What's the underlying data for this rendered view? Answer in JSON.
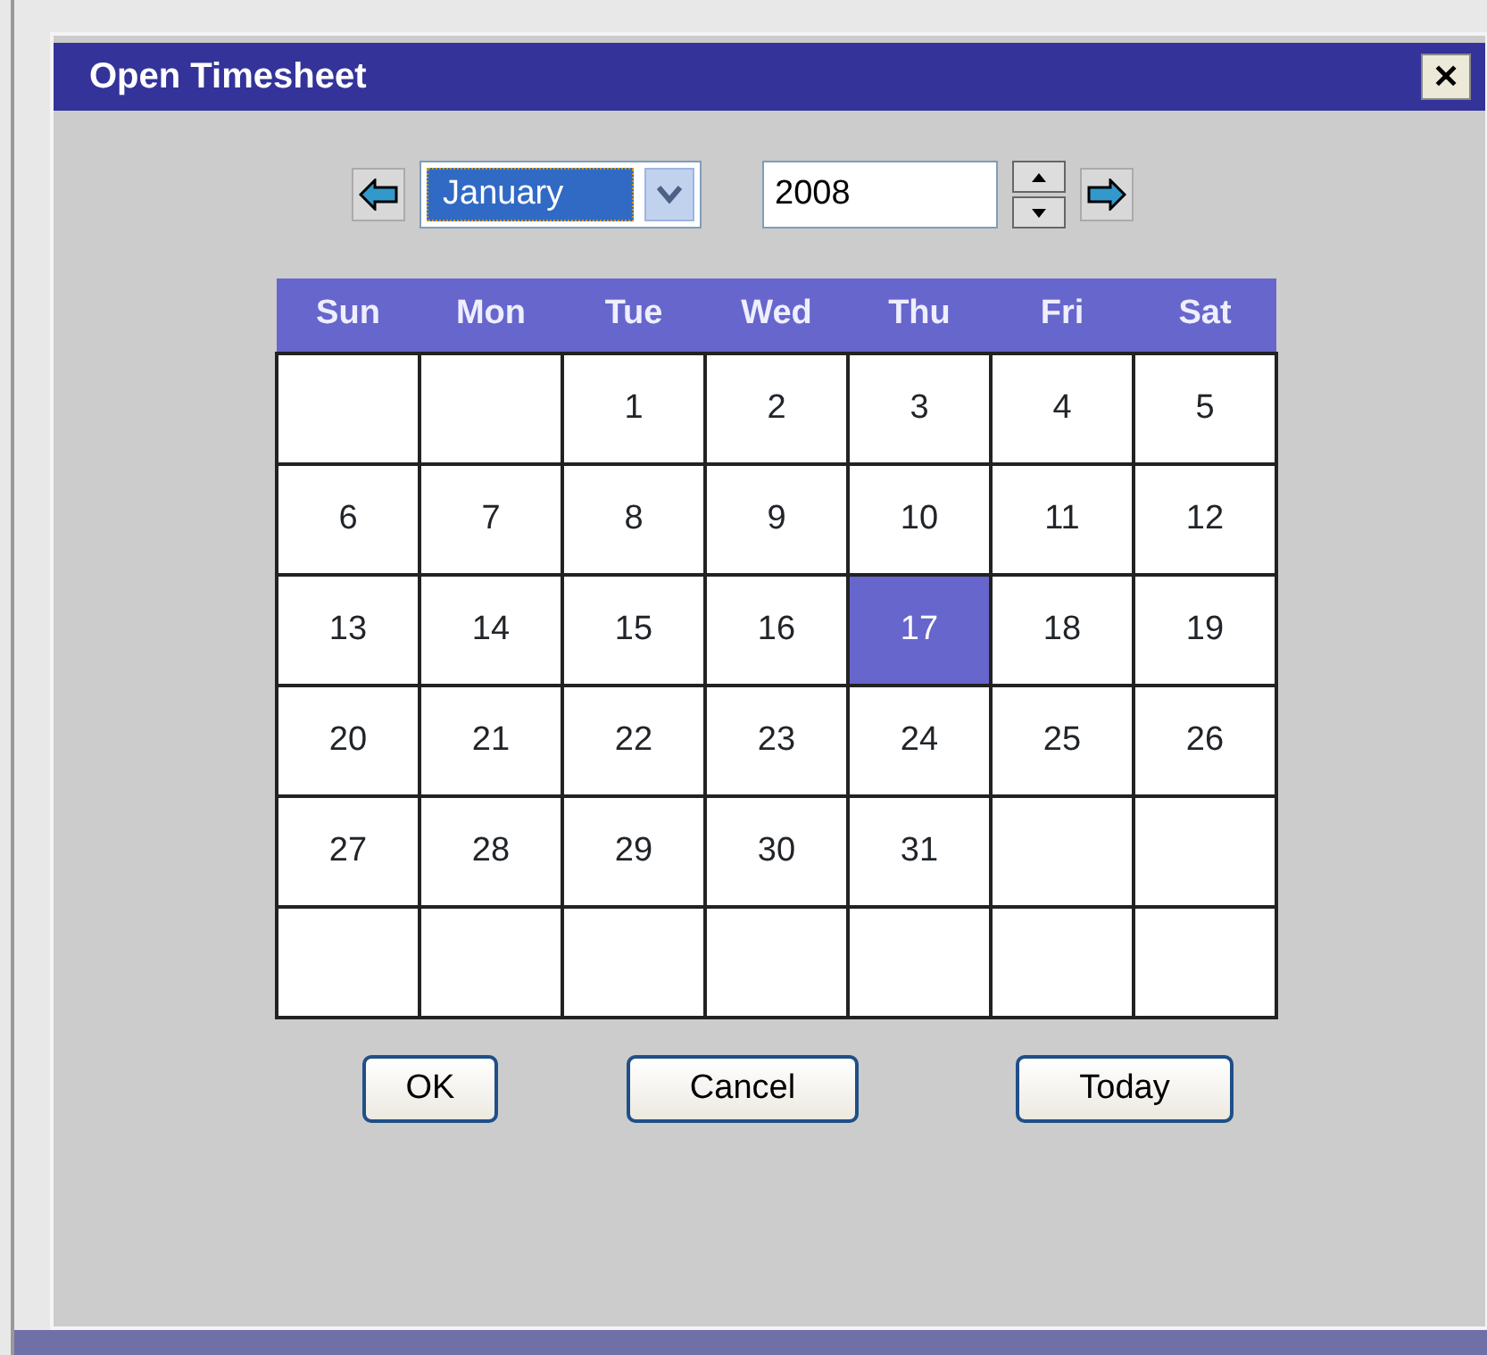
{
  "window": {
    "title": "Open Timesheet",
    "close": "✕"
  },
  "navigator": {
    "month": "January",
    "year": "2008"
  },
  "weekdays": [
    "Sun",
    "Mon",
    "Tue",
    "Wed",
    "Thu",
    "Fri",
    "Sat"
  ],
  "weeks": [
    [
      {
        "kind": "empty"
      },
      {
        "kind": "empty"
      },
      {
        "kind": "day",
        "day": "1",
        "selected": false
      },
      {
        "kind": "day",
        "day": "2",
        "selected": false
      },
      {
        "kind": "day",
        "day": "3",
        "selected": false
      },
      {
        "kind": "day",
        "day": "4",
        "selected": false
      },
      {
        "kind": "day",
        "day": "5",
        "selected": false
      }
    ],
    [
      {
        "kind": "day",
        "day": "6",
        "selected": false
      },
      {
        "kind": "day",
        "day": "7",
        "selected": false
      },
      {
        "kind": "day",
        "day": "8",
        "selected": false
      },
      {
        "kind": "day",
        "day": "9",
        "selected": false
      },
      {
        "kind": "day",
        "day": "10",
        "selected": false
      },
      {
        "kind": "day",
        "day": "11",
        "selected": false
      },
      {
        "kind": "day",
        "day": "12",
        "selected": false
      }
    ],
    [
      {
        "kind": "day",
        "day": "13",
        "selected": false
      },
      {
        "kind": "day",
        "day": "14",
        "selected": false
      },
      {
        "kind": "day",
        "day": "15",
        "selected": false
      },
      {
        "kind": "day",
        "day": "16",
        "selected": false
      },
      {
        "kind": "day",
        "day": "17",
        "selected": true
      },
      {
        "kind": "day",
        "day": "18",
        "selected": false
      },
      {
        "kind": "day",
        "day": "19",
        "selected": false
      }
    ],
    [
      {
        "kind": "day",
        "day": "20",
        "selected": false
      },
      {
        "kind": "day",
        "day": "21",
        "selected": false
      },
      {
        "kind": "day",
        "day": "22",
        "selected": false
      },
      {
        "kind": "day",
        "day": "23",
        "selected": false
      },
      {
        "kind": "day",
        "day": "24",
        "selected": false
      },
      {
        "kind": "day",
        "day": "25",
        "selected": false
      },
      {
        "kind": "day",
        "day": "26",
        "selected": false
      }
    ],
    [
      {
        "kind": "day",
        "day": "27",
        "selected": false
      },
      {
        "kind": "day",
        "day": "28",
        "selected": false
      },
      {
        "kind": "day",
        "day": "29",
        "selected": false
      },
      {
        "kind": "day",
        "day": "30",
        "selected": false
      },
      {
        "kind": "day",
        "day": "31",
        "selected": false
      },
      {
        "kind": "empty"
      },
      {
        "kind": "empty"
      }
    ],
    [
      {
        "kind": "empty"
      },
      {
        "kind": "empty"
      },
      {
        "kind": "empty"
      },
      {
        "kind": "empty"
      },
      {
        "kind": "empty"
      },
      {
        "kind": "empty"
      },
      {
        "kind": "empty"
      }
    ]
  ],
  "buttons": [
    "OK",
    "Cancel",
    "Today"
  ]
}
